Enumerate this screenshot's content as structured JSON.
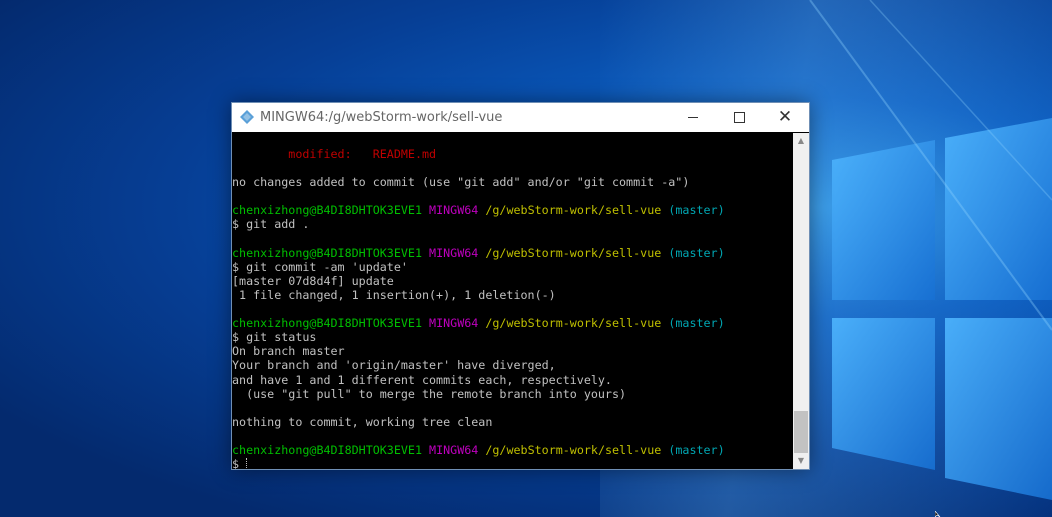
{
  "window": {
    "title": "MINGW64:/g/webStorm-work/sell-vue"
  },
  "terminal": {
    "lines": [
      [
        {
          "t": "        "
        },
        {
          "t": "modified:   README.md",
          "c": "red"
        }
      ],
      [],
      [
        {
          "t": "no changes added to commit (use \"git add\" and/or \"git commit -a\")"
        }
      ],
      [],
      [
        {
          "t": "chenxizhong@B4DI8DHTOK3EVE1",
          "c": "green"
        },
        {
          "t": " "
        },
        {
          "t": "MINGW64",
          "c": "magenta"
        },
        {
          "t": " "
        },
        {
          "t": "/g/webStorm-work/sell-vue",
          "c": "yellow"
        },
        {
          "t": " "
        },
        {
          "t": "(master)",
          "c": "cyan"
        }
      ],
      [
        {
          "t": "$ git add ."
        }
      ],
      [],
      [
        {
          "t": "chenxizhong@B4DI8DHTOK3EVE1",
          "c": "green"
        },
        {
          "t": " "
        },
        {
          "t": "MINGW64",
          "c": "magenta"
        },
        {
          "t": " "
        },
        {
          "t": "/g/webStorm-work/sell-vue",
          "c": "yellow"
        },
        {
          "t": " "
        },
        {
          "t": "(master)",
          "c": "cyan"
        }
      ],
      [
        {
          "t": "$ git commit -am 'update'"
        }
      ],
      [
        {
          "t": "[master 07d8d4f] update"
        }
      ],
      [
        {
          "t": " 1 file changed, 1 insertion(+), 1 deletion(-)"
        }
      ],
      [],
      [
        {
          "t": "chenxizhong@B4DI8DHTOK3EVE1",
          "c": "green"
        },
        {
          "t": " "
        },
        {
          "t": "MINGW64",
          "c": "magenta"
        },
        {
          "t": " "
        },
        {
          "t": "/g/webStorm-work/sell-vue",
          "c": "yellow"
        },
        {
          "t": " "
        },
        {
          "t": "(master)",
          "c": "cyan"
        }
      ],
      [
        {
          "t": "$ git status"
        }
      ],
      [
        {
          "t": "On branch master"
        }
      ],
      [
        {
          "t": "Your branch and 'origin/master' have diverged,"
        }
      ],
      [
        {
          "t": "and have 1 and 1 different commits each, respectively."
        }
      ],
      [
        {
          "t": "  (use \"git pull\" to merge the remote branch into yours)"
        }
      ],
      [],
      [
        {
          "t": "nothing to commit, working tree clean"
        }
      ],
      [],
      [
        {
          "t": "chenxizhong@B4DI8DHTOK3EVE1",
          "c": "green"
        },
        {
          "t": " "
        },
        {
          "t": "MINGW64",
          "c": "magenta"
        },
        {
          "t": " "
        },
        {
          "t": "/g/webStorm-work/sell-vue",
          "c": "yellow"
        },
        {
          "t": " "
        },
        {
          "t": "(master)",
          "c": "cyan"
        }
      ],
      [
        {
          "t": "$ "
        }
      ]
    ]
  },
  "colors": {
    "red": "#bf0000",
    "green": "#00bf00",
    "magenta": "#bf00bf",
    "yellow": "#bfbf00",
    "cyan": "#00a6b2",
    "text": "#c0c0c0",
    "background": "#000000"
  },
  "icons": {
    "app": "git-bash-icon",
    "minimize": "minimize-icon",
    "maximize": "maximize-icon",
    "close": "close-icon",
    "scroll_up": "scroll-up-arrow-icon",
    "scroll_down": "scroll-down-arrow-icon"
  }
}
